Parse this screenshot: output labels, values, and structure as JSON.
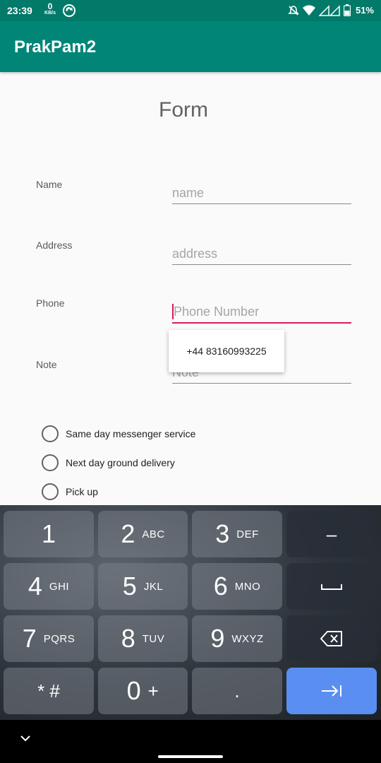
{
  "status": {
    "time": "23:39",
    "speed_value": "0",
    "speed_unit": "KB/s",
    "battery": "51%"
  },
  "app": {
    "title": "PrakPam2"
  },
  "form": {
    "title": "Form",
    "name": {
      "label": "Name",
      "placeholder": "name"
    },
    "address": {
      "label": "Address",
      "placeholder": "address"
    },
    "phone": {
      "label": "Phone",
      "placeholder": "Phone Number"
    },
    "note": {
      "label": "Note",
      "placeholder": "Note"
    },
    "autofill_suggestion": "+44 83160993225",
    "delivery_options": [
      "Same day messenger service",
      "Next day ground delivery",
      "Pick up"
    ]
  },
  "keyboard": {
    "keys": [
      {
        "num": "1",
        "letters": ""
      },
      {
        "num": "2",
        "letters": "ABC"
      },
      {
        "num": "3",
        "letters": "DEF"
      },
      {
        "num": "4",
        "letters": "GHI"
      },
      {
        "num": "5",
        "letters": "JKL"
      },
      {
        "num": "6",
        "letters": "MNO"
      },
      {
        "num": "7",
        "letters": "PQRS"
      },
      {
        "num": "8",
        "letters": "TUV"
      },
      {
        "num": "9",
        "letters": "WXYZ"
      },
      {
        "num": "0",
        "letters": "+"
      }
    ],
    "minus": "–",
    "symbols": "* #",
    "dot": "."
  },
  "colors": {
    "statusbar": "#017a6a",
    "appbar": "#008577",
    "accent": "#d81b60",
    "action_key": "#5a8ef0"
  },
  "icons": [
    "sync-icon",
    "mute-icon",
    "wifi-icon",
    "signal-icon",
    "battery-icon",
    "space-icon",
    "backspace-icon",
    "next-tab-icon",
    "chevron-down-icon"
  ]
}
